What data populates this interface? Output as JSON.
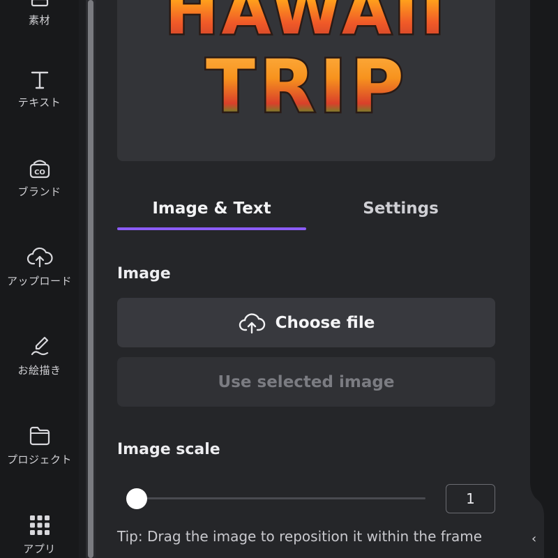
{
  "rail": {
    "items": [
      {
        "label": "素材",
        "icon": "elements-icon"
      },
      {
        "label": "テキスト",
        "icon": "text-icon"
      },
      {
        "label": "ブランド",
        "icon": "brand-icon"
      },
      {
        "label": "アップロード",
        "icon": "upload-icon"
      },
      {
        "label": "お絵描き",
        "icon": "draw-icon"
      },
      {
        "label": "プロジェクト",
        "icon": "folder-icon"
      },
      {
        "label": "アプリ",
        "icon": "apps-icon"
      }
    ]
  },
  "preview": {
    "line1": "HAWAII",
    "line2": "TRIP"
  },
  "tabs": {
    "active": "Image & Text",
    "inactive": "Settings"
  },
  "image_section": {
    "label": "Image",
    "choose_file": "Choose file",
    "use_selected": "Use selected image"
  },
  "scale_section": {
    "label": "Image scale",
    "value": "1",
    "slider_fraction": 0.0
  },
  "tip": "Tip: Drag the image to reposition it within the frame",
  "colors": {
    "accent": "#8b5cf6",
    "panel_bg": "#252629",
    "button_bg": "#38393e"
  }
}
